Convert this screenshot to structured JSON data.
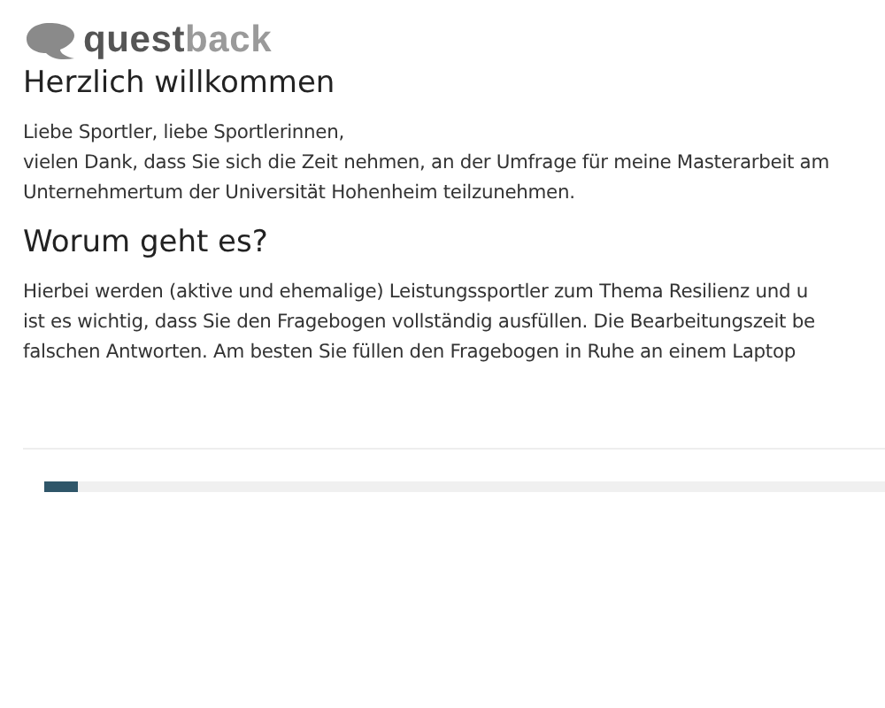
{
  "logo": {
    "part_1": "quest",
    "part_2": "back"
  },
  "sections": [
    {
      "heading": "Herzlich willkommen",
      "lines": [
        "Liebe Sportler, liebe Sportlerinnen,",
        "vielen Dank, dass Sie sich die Zeit nehmen, an der Umfrage für meine Masterarbeit am",
        "Unternehmertum der Universität Hohenheim teilzunehmen."
      ]
    },
    {
      "heading": "Worum geht es?",
      "lines": [
        "Hierbei werden (aktive und ehemalige) Leistungssportler zum Thema Resilienz und u",
        "ist es wichtig, dass Sie den Fragebogen vollständig ausfüllen. Die Bearbeitungszeit be",
        "falschen Antworten. Am besten Sie füllen den Fragebogen in Ruhe an einem Laptop"
      ]
    }
  ],
  "progress": {
    "level": 0.04
  }
}
